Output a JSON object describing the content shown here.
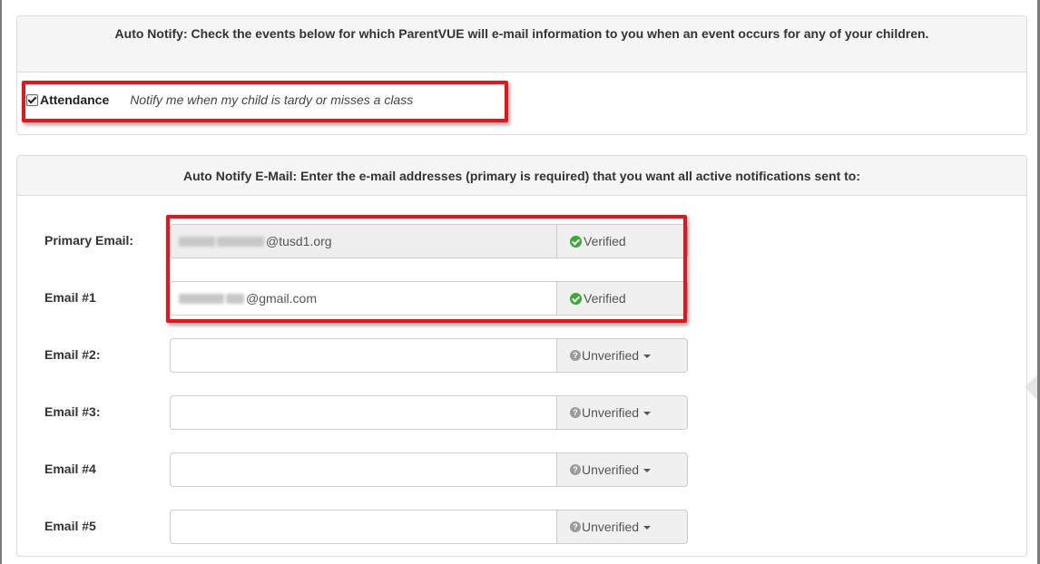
{
  "auto_notify": {
    "heading": "Auto Notify: Check the events below for which ParentVUE will e-mail information to you when an event occurs for any of your children.",
    "attendance": {
      "label": "Attendance",
      "checked": true,
      "description": "Notify me when my child is tardy or misses a class"
    }
  },
  "auto_notify_email": {
    "heading": "Auto Notify E-Mail: Enter the e-mail addresses (primary is required) that you want all active notifications sent to:",
    "rows": [
      {
        "label": "Primary Email:",
        "value": "@tusd1.org",
        "status": "Verified"
      },
      {
        "label": "Email #1",
        "value": "@gmail.com",
        "status": "Verified"
      },
      {
        "label": "Email #2:",
        "value": "",
        "status": "Unverified"
      },
      {
        "label": "Email #3:",
        "value": "",
        "status": "Unverified"
      },
      {
        "label": "Email #4",
        "value": "",
        "status": "Unverified"
      },
      {
        "label": "Email #5",
        "value": "",
        "status": "Unverified"
      }
    ]
  },
  "colors": {
    "highlight": "#e8141b",
    "verified": "#3aa935",
    "unverified": "#9b9b9b",
    "header_bg": "#f5f5f5"
  },
  "icons": {
    "verified": "check-circle-icon",
    "unverified": "question-circle-icon",
    "dropdown": "caret-down-icon"
  }
}
